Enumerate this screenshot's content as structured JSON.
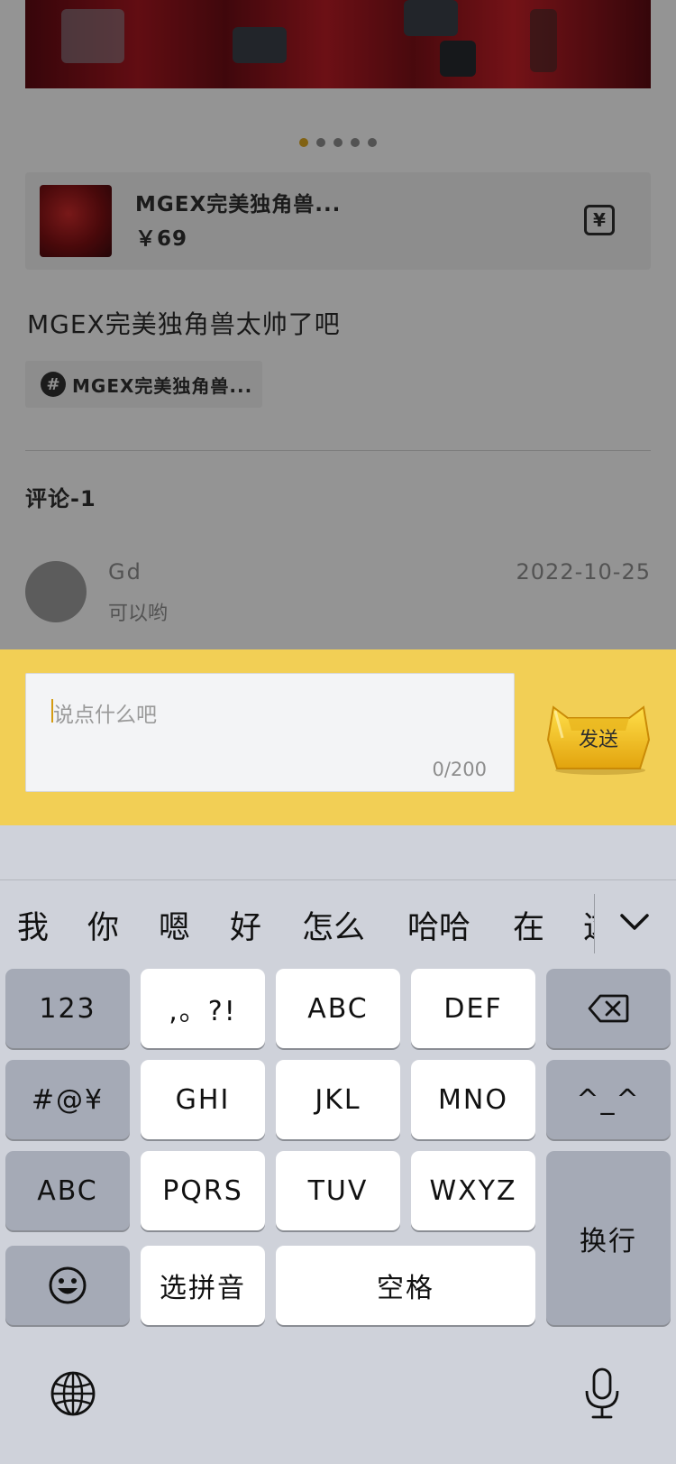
{
  "post": {
    "carousel": {
      "slides": 5,
      "active_index": 0
    },
    "product": {
      "name": "MGEX完美独角兽...",
      "price": "￥69",
      "price_icon": "yen-tag-icon"
    },
    "text": "MGEX完美独角兽太帅了吧",
    "topic": {
      "icon": "hash-icon",
      "symbol": "#",
      "label": "MGEX完美独角兽..."
    },
    "comments": {
      "title": "评论-1",
      "items": [
        {
          "user": "Gd",
          "text": "可以哟",
          "date": "2022-10-25"
        }
      ]
    }
  },
  "input": {
    "placeholder": "说点什么吧",
    "count": "0/200",
    "send_label": "发送"
  },
  "keyboard": {
    "candidates": [
      "我",
      "你",
      "嗯",
      "好",
      "怎么",
      "哈哈",
      "在",
      "这"
    ],
    "rows": [
      [
        "123",
        ",。?!",
        "ABC",
        "DEF",
        "backspace"
      ],
      [
        "#@¥",
        "GHI",
        "JKL",
        "MNO",
        "^_^"
      ],
      [
        "ABC",
        "PQRS",
        "TUV",
        "WXYZ",
        "换行"
      ],
      [
        "emoji",
        "选拼音",
        "空格"
      ]
    ],
    "labels": {
      "k_123": "123",
      "k_punct": ",。?!",
      "k_abc": "ABC",
      "k_def": "DEF",
      "k_symbols": "#@¥",
      "k_ghi": "GHI",
      "k_jkl": "JKL",
      "k_mno": "MNO",
      "k_kaomoji": "^_^",
      "k_abc_mode": "ABC",
      "k_pqrs": "PQRS",
      "k_tuv": "TUV",
      "k_wxyz": "WXYZ",
      "k_enter": "换行",
      "k_pinyin": "选拼音",
      "k_space": "空格"
    }
  },
  "colors": {
    "accent_yellow": "#f2cf55",
    "active_dot": "#d8a320",
    "keyboard_bg": "#cfd2da",
    "key_dark": "#a5aab6"
  }
}
